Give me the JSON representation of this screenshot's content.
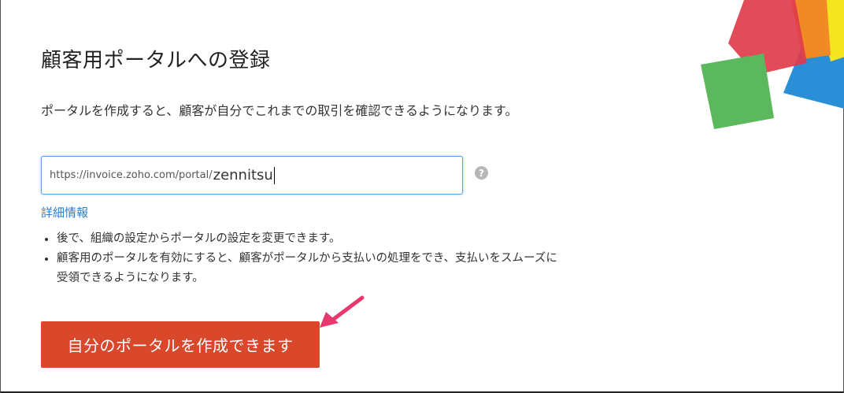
{
  "page": {
    "title": "顧客用ポータルへの登録",
    "description": "ポータルを作成すると、顧客が自分でこれまでの取引を確認できるようになります。"
  },
  "portal_url": {
    "prefix": "https://invoice.zoho.com/portal/",
    "value": "zennitsu",
    "help_icon": "?"
  },
  "more_info_link": "詳細情報",
  "notes": [
    "後で、組織の設定からポータルの設定を変更できます。",
    "顧客用のポータルを有効にすると、顧客がポータルから支払いの処理をでき、支払いをスムーズに受領できるようになります。"
  ],
  "create_button": "自分のポータルを作成できます",
  "colors": {
    "button": "#d9482b",
    "link": "#2a7fcf",
    "input_focus_border": "#5fa3e6",
    "annotation_arrow": "#e8386d",
    "decor_red": "#e03c4b",
    "decor_orange": "#f08a24",
    "decor_yellow": "#f5e51f",
    "decor_green": "#5bb85c",
    "decor_blue": "#2b8fd8"
  }
}
